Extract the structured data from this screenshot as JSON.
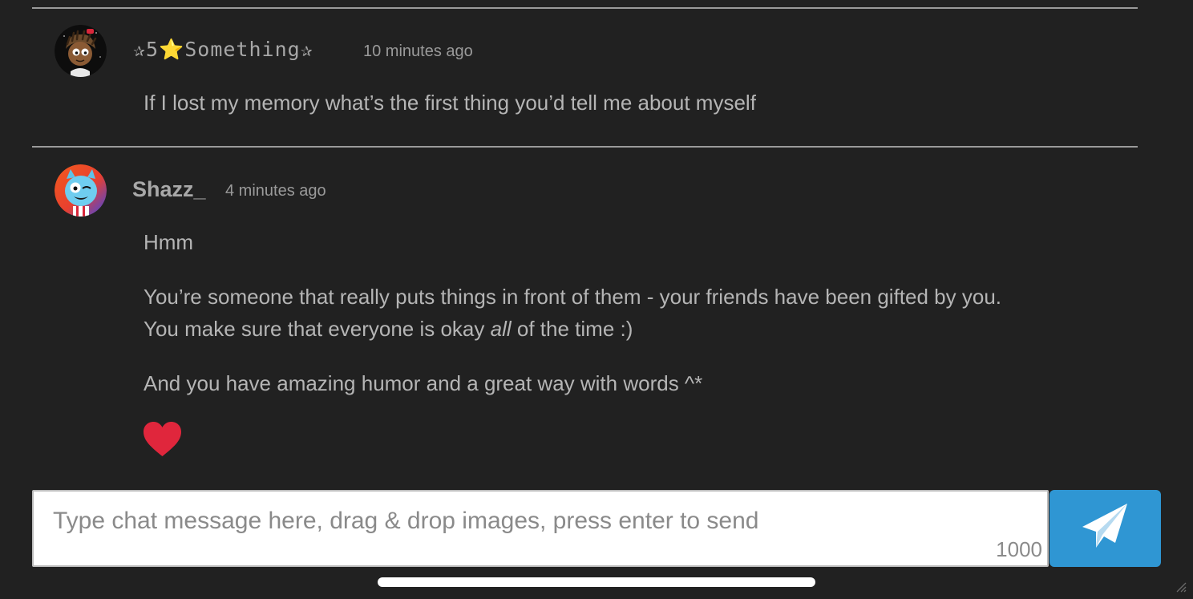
{
  "messages": [
    {
      "username": "✰5⭐Something✰",
      "timestamp": "10 minutes ago",
      "avatar_icon": "cartoon-character-avatar-icon",
      "lines": [
        "If I lost my memory what’s the first thing you’d tell me about myself"
      ]
    },
    {
      "username": "Shazz_",
      "timestamp": "4 minutes ago",
      "avatar_icon": "gumball-cat-avatar-icon",
      "lines": [
        "Hmm",
        "You’re someone that really puts things in front of them - your friends have been gifted by you.",
        "You make sure that everyone is okay",
        "all",
        "of the time :)",
        "And you have amazing humor and a great way with words ^*"
      ],
      "emoji": "heart-icon"
    }
  ],
  "composer": {
    "placeholder": "Type chat message here, drag & drop images, press enter to send",
    "value": "",
    "char_count": "1000",
    "send_icon": "paper-plane-icon"
  },
  "colors": {
    "background": "#212121",
    "send_button": "#2f96d3",
    "heart": "#e0263c"
  }
}
